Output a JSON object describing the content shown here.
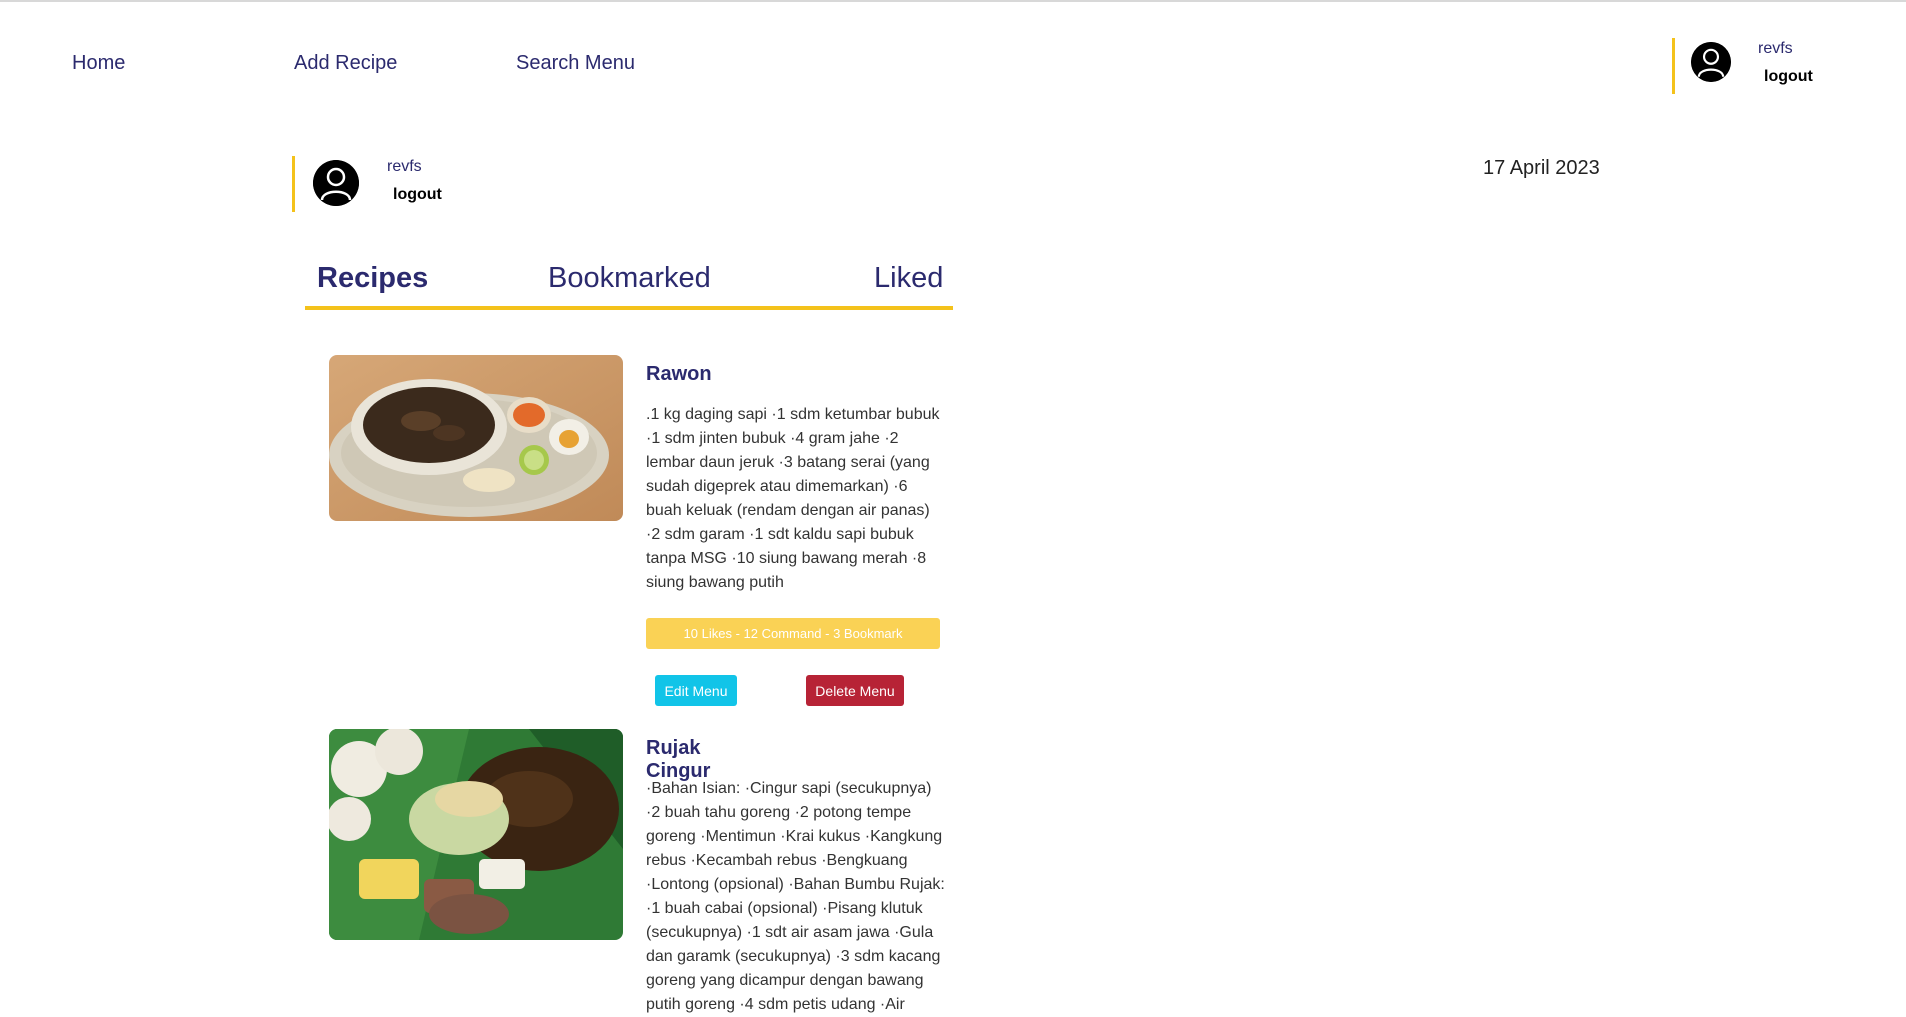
{
  "nav": {
    "home": "Home",
    "add_recipe": "Add Recipe",
    "search_menu": "Search Menu"
  },
  "header_user": {
    "username": "revfs",
    "logout": "logout"
  },
  "profile": {
    "username": "revfs",
    "logout": "logout",
    "date": "17 April 2023"
  },
  "tabs": {
    "recipes": "Recipes",
    "bookmarked": "Bookmarked",
    "liked": "Liked",
    "active": "Recipes"
  },
  "recipes": [
    {
      "title": "Rawon",
      "description": ".1 kg daging sapi ·1 sdm ketumbar bubuk ·1 sdm jinten bubuk ·4 gram jahe ·2 lembar daun jeruk ·3 batang serai (yang sudah digeprek atau dimemarkan) ·6 buah keluak (rendam dengan air panas) ·2 sdm garam ·1 sdt kaldu sapi bubuk tanpa MSG ·10 siung bawang merah ·8 siung bawang putih",
      "stats": "10 Likes - 12 Command - 3 Bookmark",
      "edit_label": "Edit Menu",
      "delete_label": "Delete Menu"
    },
    {
      "title": "Rujak Cingur",
      "description": "·Bahan Isian: ·Cingur sapi (secukupnya) ·2 buah tahu goreng ·2 potong tempe goreng ·Mentimun ·Krai kukus ·Kangkung rebus ·Kecambah rebus ·Bengkuang ·Lontong (opsional) ·Bahan Bumbu Rujak: ·1 buah cabai (opsional) ·Pisang klutuk (secukupnya) ·1 sdt air asam jawa ·Gula dan garamk (secukupnya) ·3 sdm kacang goreng yang dicampur dengan bawang putih goreng ·4 sdm petis udang ·Air"
    }
  ],
  "colors": {
    "primary_text": "#2b2a6e",
    "accent_yellow": "#f4c21b",
    "stats_bg": "#fad255",
    "edit_btn": "#11c4e8",
    "delete_btn": "#b72336"
  }
}
